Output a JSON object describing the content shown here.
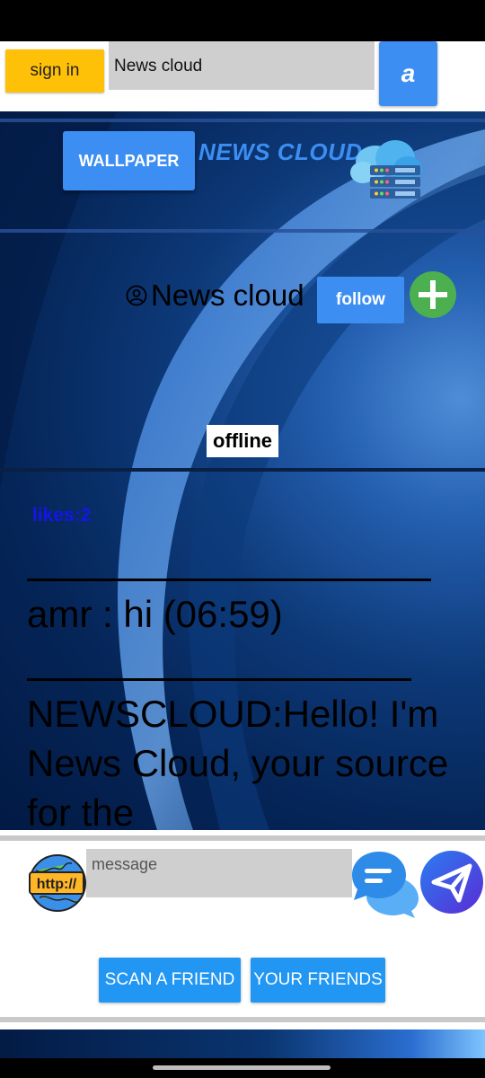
{
  "topbar": {
    "signin_label": "sign in",
    "search_value": "News cloud",
    "a_button_label": "a"
  },
  "header": {
    "wallpaper_label": "WALLPAPER",
    "brand_title": "NEWS CLOUD",
    "logo_icon": "cloud-server-icon"
  },
  "profile": {
    "user_icon": "user-circle-icon",
    "name": "News cloud",
    "follow_label": "follow",
    "add_icon": "plus-circle-icon",
    "status": "offline",
    "likes": "likes:2"
  },
  "chat": {
    "messages": [
      "amr : hi (06:59)",
      "NEWSCLOUD:Hello! I'm News Cloud, your source for the"
    ]
  },
  "composer": {
    "placeholder": "message",
    "http_icon": "http-globe-icon",
    "chat_icon": "chat-bubbles-icon",
    "send_icon": "send-icon",
    "scan_label": "SCAN A FRIEND",
    "friends_label": "YOUR FRIENDS"
  },
  "colors": {
    "accent": "#3d8ef2",
    "signin": "#FFC107",
    "likes": "#1515e8",
    "plus": "#4caf50"
  }
}
